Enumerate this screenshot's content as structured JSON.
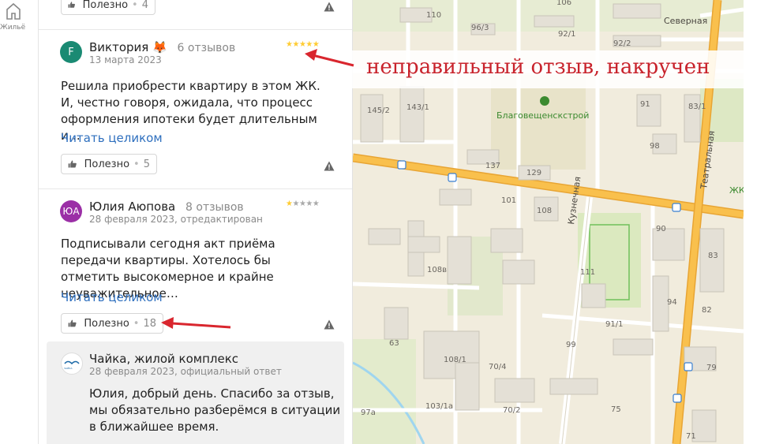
{
  "rail": {
    "label": "Жильё",
    "icon": "home-icon"
  },
  "top_like": {
    "label": "Полезно",
    "count": "4"
  },
  "reviews": [
    {
      "avatar_text": "F",
      "avatar_color": "#1a8a73",
      "author": "Виктория 🦊",
      "reviews_count": "6 отзывов",
      "date": "13 марта 2023",
      "rating": 5,
      "text": "Решила приобрести квартиру в этом ЖК. И, честно говоря, ожидала, что процесс оформления ипотеки будет длительным и…",
      "read_more": "Читать целиком",
      "like_label": "Полезно",
      "like_count": "5"
    },
    {
      "avatar_text": "ЮА",
      "avatar_color": "#9b2fa6",
      "author": "Юлия Аюпова",
      "reviews_count": "8 отзывов",
      "date": "28 февраля 2023, отредактирован",
      "rating": 1,
      "text": "Подписывали сегодня акт приёма передачи квартиры. Хотелось бы отметить высокомерное и крайне неуважительное…",
      "read_more": "Читать целиком",
      "like_label": "Полезно",
      "like_count": "18"
    }
  ],
  "owner_reply": {
    "name": "Чайка, жилой комплекс",
    "date": "28 февраля 2023, официальный ответ",
    "text": "Юлия, добрый день. Спасибо за отзыв, мы обязательно разберёмся в ситуации в ближайшее время.",
    "logo_text": "ЧАЙКА"
  },
  "annotation": {
    "text": "неправильный отзыв, накручен",
    "color": "#c8232c"
  },
  "map": {
    "streets": [
      "Северная",
      "Театральная",
      "Кузнечная"
    ],
    "poi": "Благовещенскстрой",
    "poi_cut": "ЖК",
    "house_numbers": [
      "110",
      "106",
      "96/3",
      "92/1",
      "92/2",
      "91",
      "83/1",
      "145/2",
      "143/1",
      "98",
      "137",
      "129",
      "108",
      "101",
      "90",
      "83",
      "108в",
      "111",
      "94",
      "91/1",
      "82",
      "63",
      "108/1",
      "99",
      "79",
      "70/4",
      "97а",
      "103/1а",
      "70/2",
      "75",
      "71"
    ],
    "colors": {
      "base": "#f1ecdd",
      "road": "#ffffff",
      "major_road": "#f9c04d",
      "major_road_outline": "#e8a534",
      "green": "#d8e6b8",
      "building": "#e4e0d6",
      "building_outline": "#c9c4b8",
      "water": "#9fd5ef"
    }
  }
}
